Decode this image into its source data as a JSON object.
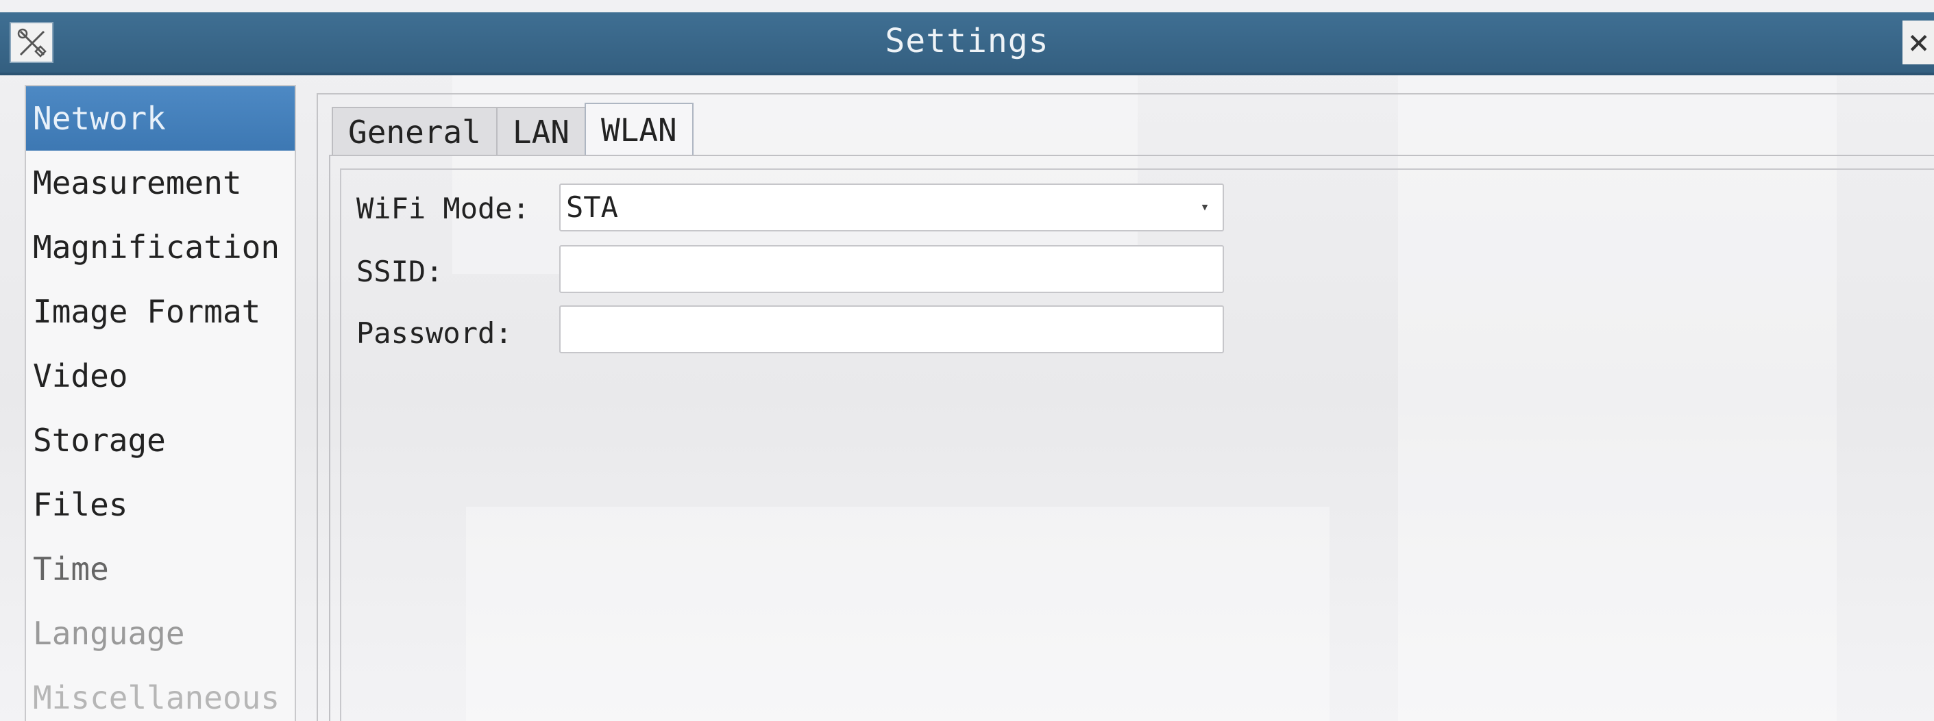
{
  "window": {
    "title": "Settings",
    "close_label": "×"
  },
  "categories": [
    {
      "label": "Network",
      "selected": true
    },
    {
      "label": "Measurement"
    },
    {
      "label": "Magnification"
    },
    {
      "label": "Image Format"
    },
    {
      "label": "Video"
    },
    {
      "label": "Storage"
    },
    {
      "label": "Files"
    },
    {
      "label": "Time"
    },
    {
      "label": "Language"
    },
    {
      "label": "Miscellaneous"
    }
  ],
  "tabs": [
    {
      "label": "General"
    },
    {
      "label": "LAN"
    },
    {
      "label": "WLAN",
      "active": true
    }
  ],
  "form": {
    "wifi_mode_label": "WiFi Mode:",
    "wifi_mode_value": "STA",
    "ssid_label": "SSID:",
    "ssid_value": "",
    "password_label": "Password:",
    "password_value": ""
  },
  "colors": {
    "titlebar": "#3f6f93",
    "selection": "#4d89c4"
  },
  "icons": {
    "app": "tools-icon",
    "close": "close-icon",
    "dropdown": "chevron-down-icon"
  }
}
